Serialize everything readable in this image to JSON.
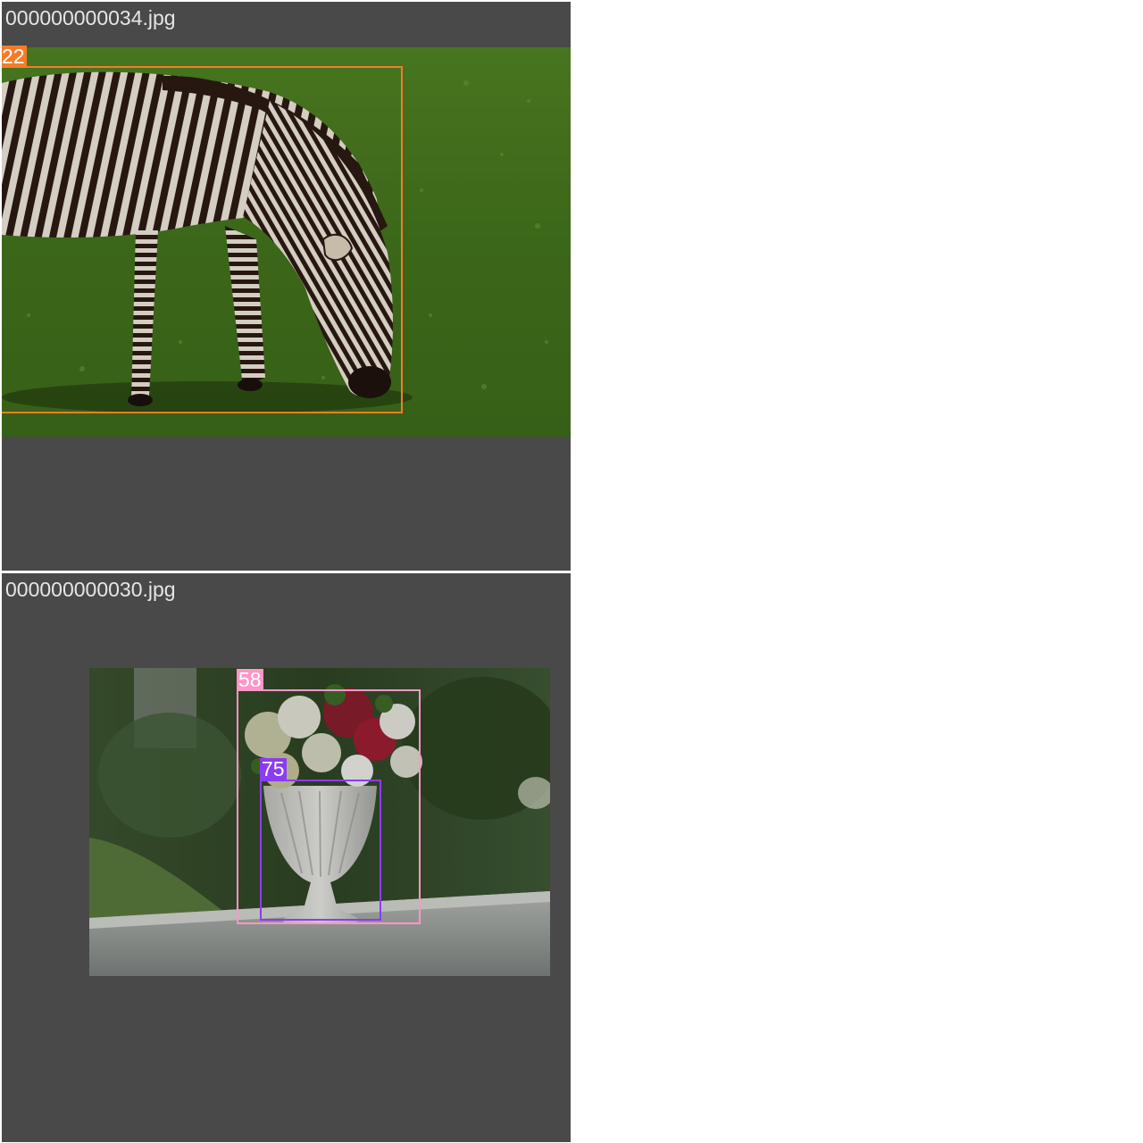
{
  "tiles": [
    {
      "filename": "000000000034.jpg",
      "detections": [
        {
          "label": "22",
          "color": "#f47c29"
        }
      ]
    },
    {
      "filename": "000000000030.jpg",
      "detections": [
        {
          "label": "58",
          "color": "#ff96c8"
        },
        {
          "label": "75",
          "color": "#8c3cf0"
        }
      ]
    }
  ],
  "colors": {
    "tile_background": "#494949",
    "page_background": "#ffffff",
    "filename_text": "#e6e6e6",
    "grass": "#3f6b1c",
    "zebra_dark": "#2a1b14",
    "zebra_light": "#e8e2d6"
  }
}
